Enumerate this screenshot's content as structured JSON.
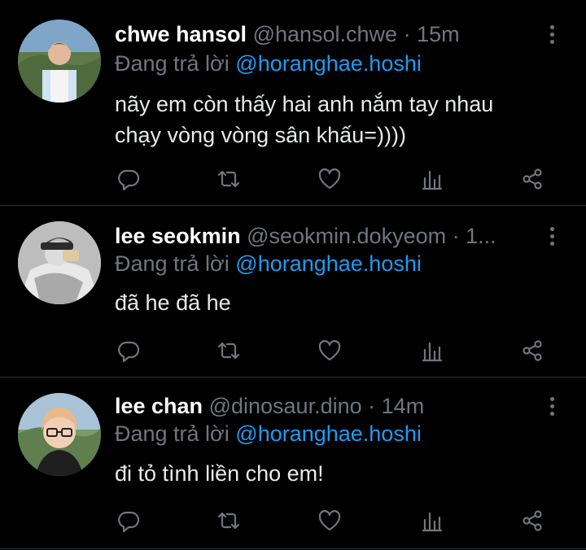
{
  "colors": {
    "background": "#000000",
    "divider": "#2f3336",
    "muted": "#71767b",
    "link": "#1d9bf0",
    "text": "#e7e9ea"
  },
  "tweets": [
    {
      "display_name": "chwe hansol",
      "handle": "@hansol.chwe",
      "separator": "·",
      "time": "15m",
      "reply_prefix": "Đang trả lời",
      "reply_to": "@horanghae.hoshi",
      "text_lines": [
        "nãy em còn thấy hai anh nắm tay nhau",
        "chạy vòng vòng sân khấu=))))"
      ],
      "icons": [
        "reply-icon",
        "retweet-icon",
        "like-icon",
        "views-icon",
        "share-icon"
      ]
    },
    {
      "display_name": "lee seokmin",
      "handle": "@seokmin.dokyeom",
      "separator": "·",
      "time": "1...",
      "reply_prefix": "Đang trả lời",
      "reply_to": "@horanghae.hoshi",
      "text_lines": [
        "đã he đã he"
      ],
      "icons": [
        "reply-icon",
        "retweet-icon",
        "like-icon",
        "views-icon",
        "share-icon"
      ]
    },
    {
      "display_name": "lee chan",
      "handle": "@dinosaur.dino",
      "separator": "·",
      "time": "14m",
      "reply_prefix": "Đang trả lời",
      "reply_to": "@horanghae.hoshi",
      "text_lines": [
        "đi tỏ tình liền cho em!"
      ],
      "icons": [
        "reply-icon",
        "retweet-icon",
        "like-icon",
        "views-icon",
        "share-icon"
      ]
    }
  ]
}
